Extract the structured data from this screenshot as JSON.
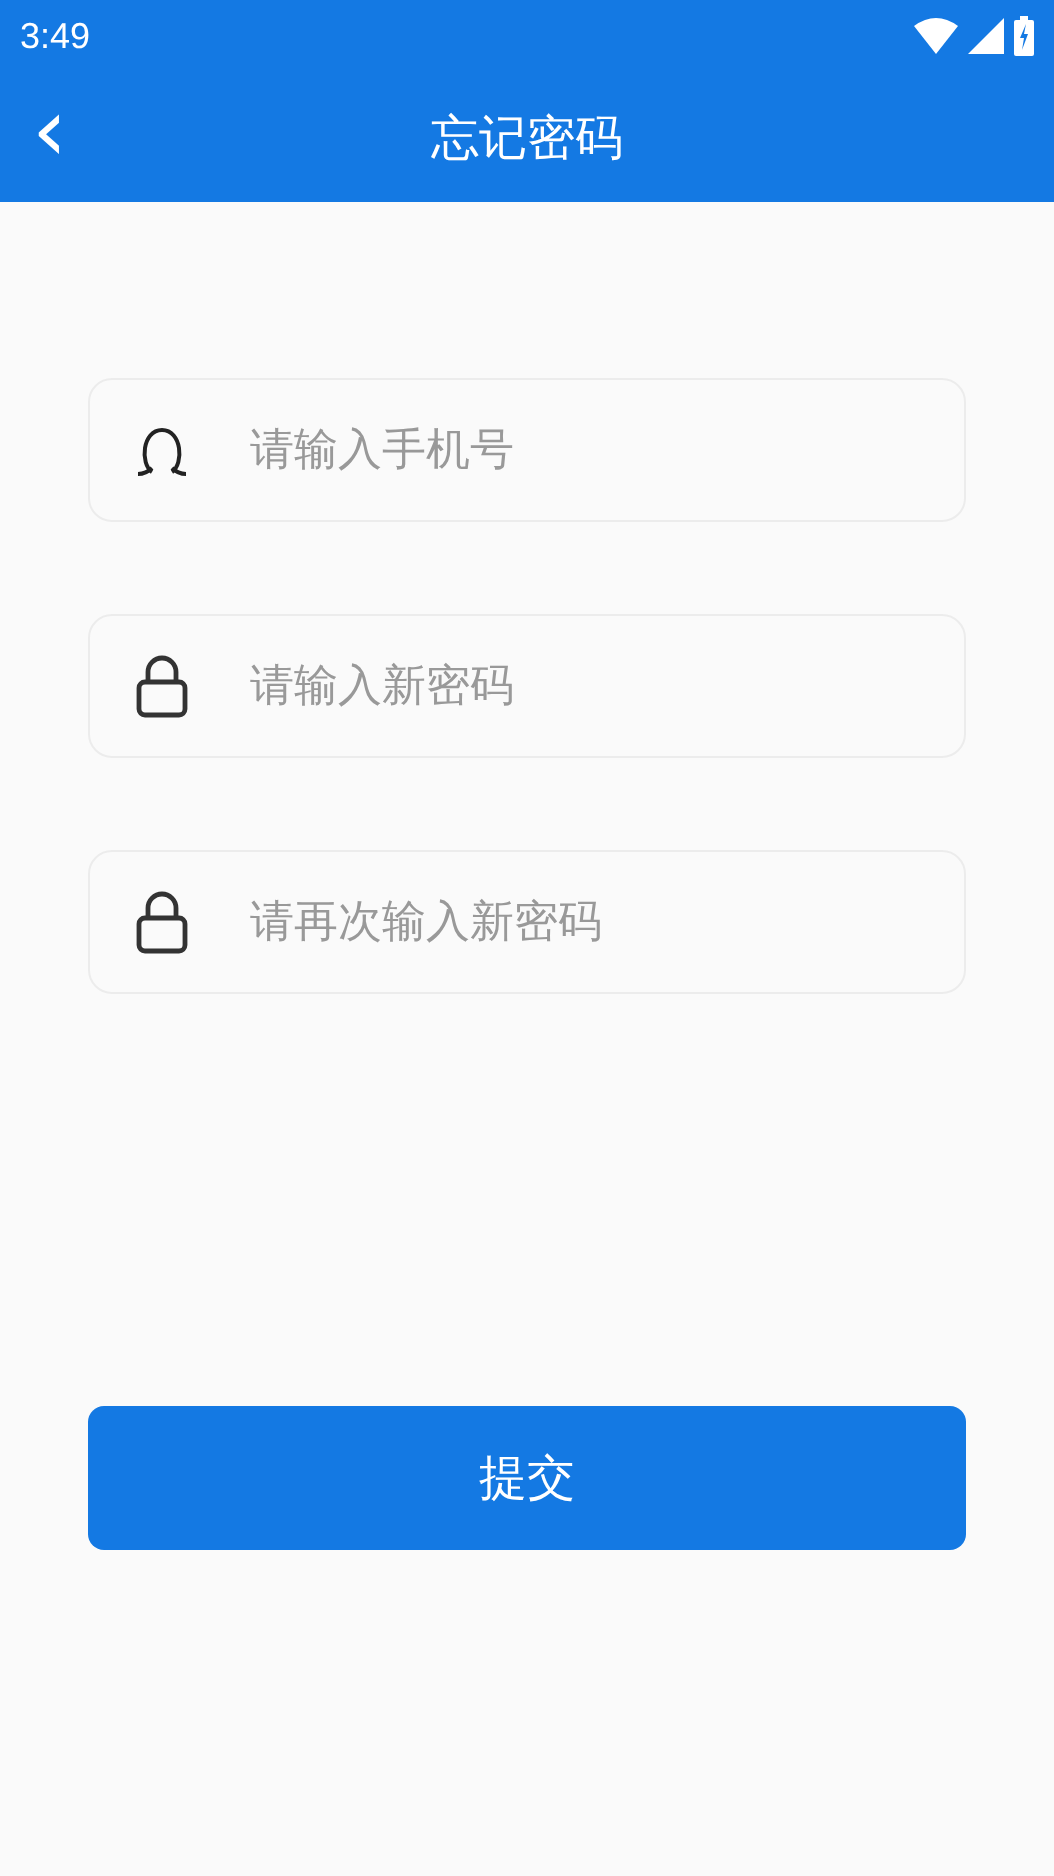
{
  "status_bar": {
    "time": "3:49"
  },
  "app_bar": {
    "back": "‹",
    "title": "忘记密码"
  },
  "fields": [
    {
      "kind": "user",
      "placeholder": "请输入手机号"
    },
    {
      "kind": "lock",
      "placeholder": "请输入新密码"
    },
    {
      "kind": "lock",
      "placeholder": "请再次输入新密码"
    }
  ],
  "submit_button": "提交"
}
